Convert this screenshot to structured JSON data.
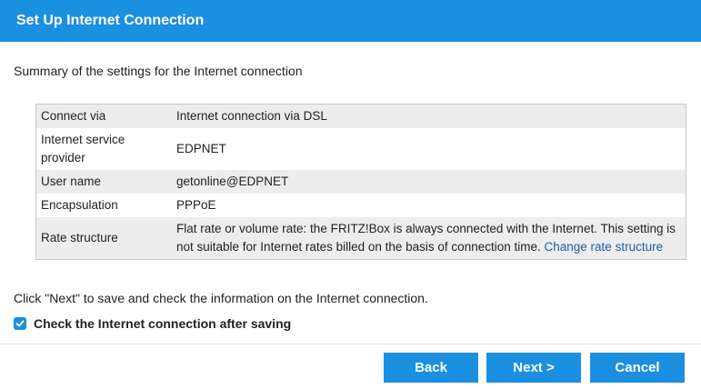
{
  "header": {
    "title": "Set Up Internet Connection"
  },
  "summary": {
    "text": "Summary of the settings for the Internet connection"
  },
  "settings": {
    "rows": [
      {
        "label": "Connect via",
        "value": "Internet connection via DSL"
      },
      {
        "label": "Internet service provider",
        "value": "EDPNET"
      },
      {
        "label": "User name",
        "value": "getonline@EDPNET"
      },
      {
        "label": "Encapsulation",
        "value": "PPPoE"
      },
      {
        "label": "Rate structure",
        "value": "Flat rate or volume rate: the FRITZ!Box is always connected with the Internet. This setting is not suitable for Internet rates billed on the basis of connection time.",
        "link": "Change rate structure"
      }
    ]
  },
  "note": {
    "text": "Click \"Next\" to save and check the information on the Internet connection."
  },
  "check": {
    "label": "Check the Internet connection after saving",
    "checked": true
  },
  "buttons": {
    "back": "Back",
    "next": "Next >",
    "cancel": "Cancel"
  },
  "colors": {
    "accent": "#1b8fe0",
    "link": "#1b5fa8",
    "row_shade": "#ededed"
  }
}
